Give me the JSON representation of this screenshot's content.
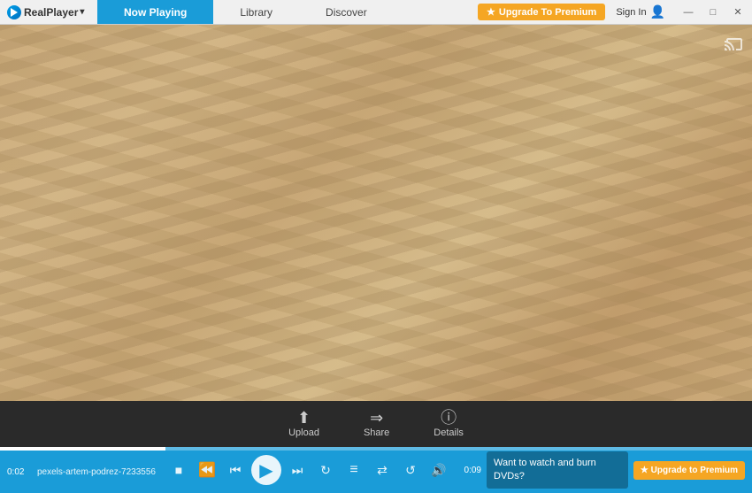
{
  "app": {
    "logo_text": "RealPlayer",
    "logo_dropdown": "▾"
  },
  "nav": {
    "tabs": [
      {
        "label": "Now Playing",
        "active": true
      },
      {
        "label": "Library",
        "active": false
      },
      {
        "label": "Discover",
        "active": false
      }
    ]
  },
  "titlebar": {
    "upgrade_label": "Upgrade To Premium",
    "star": "★",
    "signin_label": "Sign In",
    "minimize": "—",
    "restore": "□",
    "close": "✕"
  },
  "toolbar": {
    "upload_label": "Upload",
    "share_label": "Share",
    "details_label": "Details",
    "upload_icon": "⬆",
    "share_icon": "⇒",
    "details_icon": "ⓘ"
  },
  "player": {
    "time_current": "0:02",
    "time_total": "0:09",
    "filename": "pexels-artem-podrez-7233556",
    "progress_percent": 22,
    "stop_icon": "■",
    "rewind_icon": "↺",
    "prev_icon": "⏮",
    "play_icon": "▶",
    "next_icon": "⏭",
    "repeat_icon": "↻",
    "playlist_icon": "≡",
    "shuffle_icon": "⇄",
    "loop_icon": "↺",
    "volume_icon": "🔊",
    "promo_text_line1": "Want to watch",
    "promo_text_line2": "and burn DVDs?",
    "promo_upgrade_label": "★ Upgrade to Premium"
  }
}
